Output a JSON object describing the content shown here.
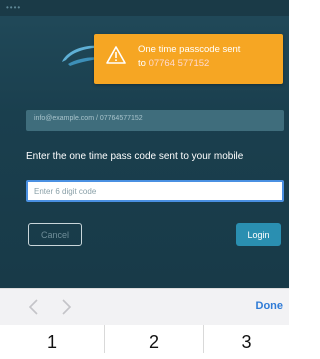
{
  "status_bar": {
    "carrier": "•••• ",
    "time": "",
    "battery": ""
  },
  "toast": {
    "icon": "warning-icon",
    "line1": "One time passcode sent",
    "line2_prefix": "to ",
    "phone": "07764 577152"
  },
  "form": {
    "email_value": "info@example.com / 07764577152",
    "prompt": "Enter the one time pass code sent to your mobile",
    "otp_placeholder": "Enter 6 digit code",
    "otp_value": "",
    "cancel_label": "Cancel",
    "login_label": "Login"
  },
  "keyboard": {
    "prev_icon": "chevron-left-icon",
    "next_icon": "chevron-right-icon",
    "done_label": "Done",
    "keys": [
      "1",
      "2",
      "3"
    ]
  },
  "colors": {
    "app_background": "#1a3f4e",
    "toast_background": "#f6a623",
    "login_button": "#2a8fb1",
    "done_text": "#2f7bd6"
  }
}
